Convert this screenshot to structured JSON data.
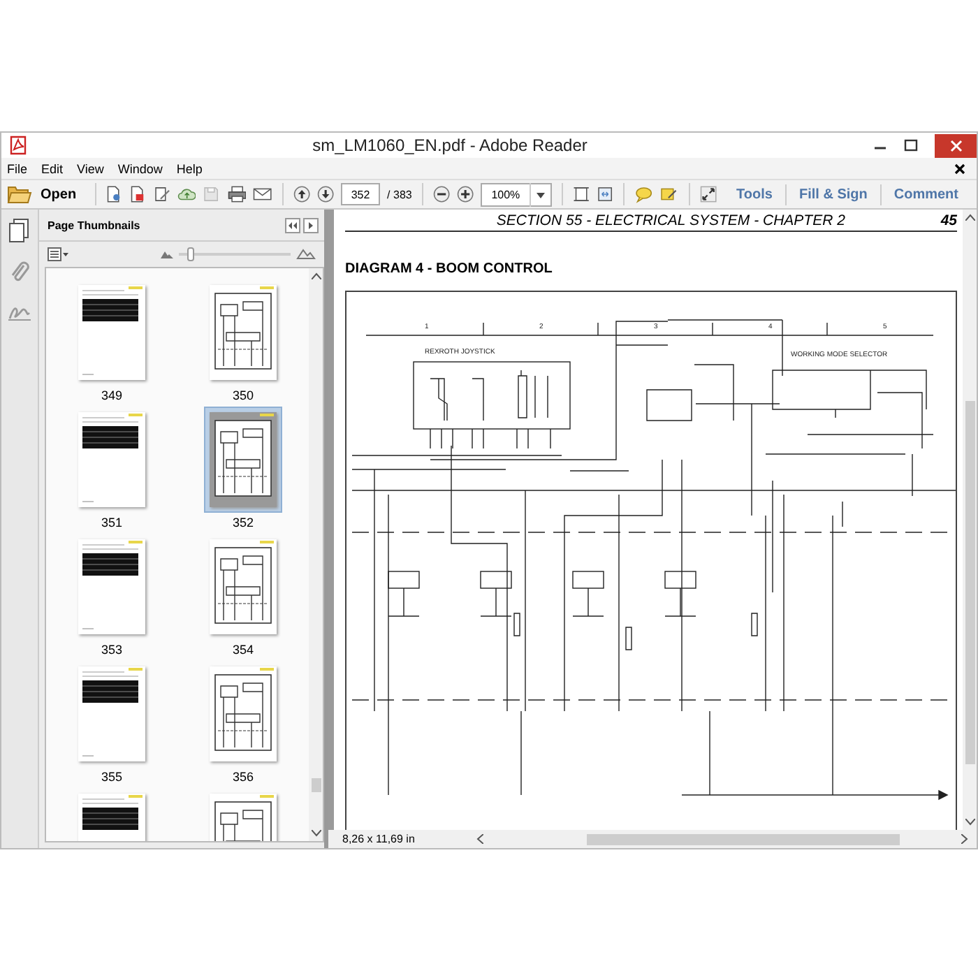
{
  "window": {
    "title": "sm_LM1060_EN.pdf - Adobe Reader"
  },
  "menu": [
    "File",
    "Edit",
    "View",
    "Window",
    "Help"
  ],
  "toolbar": {
    "open_label": "Open",
    "page_value": "352",
    "page_total": "/ 383",
    "zoom_value": "100%",
    "panels": [
      "Tools",
      "Fill & Sign",
      "Comment"
    ]
  },
  "sidebar": {
    "title": "Page Thumbnails",
    "size_slider": {
      "level": 0.08
    },
    "thumbnails": [
      {
        "label": "349",
        "kind": "table",
        "selected": false
      },
      {
        "label": "350",
        "kind": "diagram",
        "selected": false
      },
      {
        "label": "351",
        "kind": "table",
        "selected": false
      },
      {
        "label": "352",
        "kind": "diagram",
        "selected": true
      },
      {
        "label": "353",
        "kind": "table",
        "selected": false
      },
      {
        "label": "354",
        "kind": "diagram",
        "selected": false
      },
      {
        "label": "355",
        "kind": "table",
        "selected": false
      },
      {
        "label": "356",
        "kind": "diagram",
        "selected": false
      },
      {
        "kind": "table",
        "selected": false
      },
      {
        "kind": "diagram",
        "selected": false
      }
    ]
  },
  "document": {
    "header": "SECTION 55 - ELECTRICAL SYSTEM - CHAPTER 2",
    "page_number": "45",
    "heading": "DIAGRAM 4 - BOOM CONTROL",
    "diagram": {
      "columns": [
        "1",
        "2",
        "3",
        "4",
        "5"
      ],
      "labels": [
        "REXROTH JOYSTICK",
        "WORKING MODE SELECTOR"
      ]
    }
  },
  "status_bar": {
    "page_size": "8,26 x 11,69 in"
  }
}
